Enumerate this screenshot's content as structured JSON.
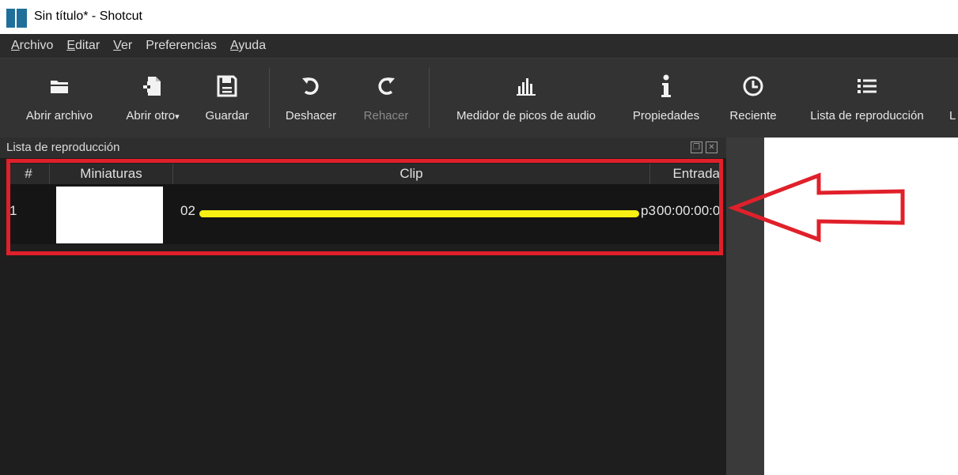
{
  "window": {
    "title": "Sin título* - Shotcut"
  },
  "menu": [
    {
      "label_ul": "A",
      "label_rest": "rchivo"
    },
    {
      "label_ul": "E",
      "label_rest": "ditar"
    },
    {
      "label_ul": "V",
      "label_rest": "er"
    },
    {
      "label_ul": "",
      "label_rest": "Preferencias"
    },
    {
      "label_ul": "A",
      "label_rest": "yuda"
    }
  ],
  "toolbar": {
    "open_file": "Abrir archivo",
    "open_other": "Abrir otro",
    "save": "Guardar",
    "undo": "Deshacer",
    "redo": "Rehacer",
    "audio_peak": "Medidor de picos de audio",
    "properties": "Propiedades",
    "recent": "Reciente",
    "playlist": "Lista de reproducción",
    "overflow": "L"
  },
  "panel": {
    "title": "Lista de reproducción",
    "float_icon": "float-icon",
    "close_icon": "close-icon"
  },
  "table": {
    "headers": [
      "#",
      "Miniaturas",
      "Clip",
      "Entrada"
    ],
    "rows": [
      {
        "num": "1",
        "clip_prefix": "02",
        "clip_suffix": "p3",
        "in": "00:00:00:0"
      }
    ]
  },
  "colors": {
    "highlight": "#e0202a",
    "redaction": "#f7f213",
    "app_icon": "#1f6f9a"
  }
}
